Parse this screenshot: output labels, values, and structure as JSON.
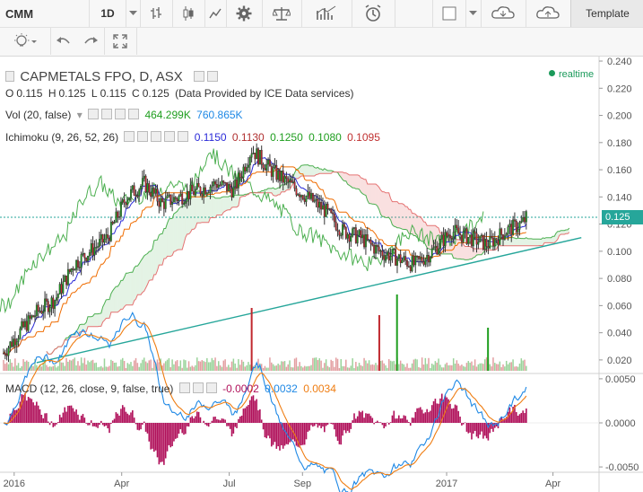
{
  "toolbar": {
    "symbol": "CMM",
    "timeframe": "1D",
    "template_label": "Template",
    "icons": [
      "chevron-down-icon",
      "bar-style-icon",
      "candles-icon",
      "area-style-icon",
      "settings-icon",
      "balance-icon",
      "indicators-icon",
      "add-alert-icon",
      "rectangle-icon",
      "chevron-down-icon",
      "cloud-load-icon",
      "cloud-save-icon"
    ],
    "row2_icons": [
      "bulb-icon",
      "undo-icon",
      "redo-icon",
      "fullscreen-icon"
    ]
  },
  "legend": {
    "title": "CAPMETALS FPO, D, ASX",
    "ohlc": {
      "o_label": "O",
      "o": "0.115",
      "h_label": "H",
      "h": "0.125",
      "l_label": "L",
      "l": "0.115",
      "c_label": "C",
      "c": "0.125"
    },
    "provider": "(Data Provided by ICE Data services)",
    "vol_label": "Vol (20, false)",
    "vol_value1": "464.299K",
    "vol_value2": "760.865K",
    "ichimoku_label": "Ichimoku (9, 26, 52, 26)",
    "ichimoku_values": [
      "0.1150",
      "0.1130",
      "0.1250",
      "0.1080",
      "0.1095"
    ],
    "ichimoku_colors": [
      "#2a2ad8",
      "#b03030",
      "#1f9e1f",
      "#1f9e1f",
      "#c03030"
    ],
    "macd_label": "MACD (12, 26, close, 9, false, true)",
    "macd_values": [
      "-0.0002",
      "0.0032",
      "0.0034"
    ],
    "macd_colors": [
      "#b0105a",
      "#1e88e5",
      "#ef7d12"
    ],
    "realtime": "realtime"
  },
  "colors": {
    "up": "#1f9e1f",
    "down": "#c0282e",
    "trend": "#26a69a",
    "tenkan": "#2a2ad8",
    "kijun": "#ef6c00",
    "lead_a": "#4caf50",
    "lead_b": "#e57373",
    "chikou": "#4caf50",
    "macd": "#1e88e5",
    "signal": "#ef7d12",
    "hist": "#b0105a"
  },
  "price_axis": {
    "ticks": [
      "0.240",
      "0.220",
      "0.200",
      "0.180",
      "0.160",
      "0.140",
      "0.120",
      "0.100",
      "0.080",
      "0.060",
      "0.040",
      "0.020"
    ],
    "last_price": "0.125"
  },
  "macd_axis": {
    "ticks": [
      "0.0050",
      "0.0000",
      "-0.0050"
    ]
  },
  "time_axis": {
    "ticks": [
      "2016",
      "Apr",
      "Jul",
      "Sep",
      "2017",
      "Apr"
    ]
  },
  "chart_data": {
    "type": "candlestick",
    "title": "CAPMETALS FPO, D, ASX",
    "ylim": [
      0.012,
      0.242
    ],
    "x_range": [
      "2015-12-20",
      "2017-05-10"
    ],
    "price_path": [
      {
        "date": "2015-12-23",
        "close": 0.025
      },
      {
        "date": "2016-01-05",
        "close": 0.04
      },
      {
        "date": "2016-01-20",
        "close": 0.055
      },
      {
        "date": "2016-02-05",
        "close": 0.065
      },
      {
        "date": "2016-02-20",
        "close": 0.09
      },
      {
        "date": "2016-03-05",
        "close": 0.1
      },
      {
        "date": "2016-03-20",
        "close": 0.11
      },
      {
        "date": "2016-04-05",
        "close": 0.14
      },
      {
        "date": "2016-04-20",
        "close": 0.15
      },
      {
        "date": "2016-05-05",
        "close": 0.135
      },
      {
        "date": "2016-05-20",
        "close": 0.14
      },
      {
        "date": "2016-06-05",
        "close": 0.145
      },
      {
        "date": "2016-06-20",
        "close": 0.15
      },
      {
        "date": "2016-07-05",
        "close": 0.145
      },
      {
        "date": "2016-07-20",
        "close": 0.175
      },
      {
        "date": "2016-08-05",
        "close": 0.16
      },
      {
        "date": "2016-08-20",
        "close": 0.15
      },
      {
        "date": "2016-09-05",
        "close": 0.14
      },
      {
        "date": "2016-09-20",
        "close": 0.13
      },
      {
        "date": "2016-10-05",
        "close": 0.115
      },
      {
        "date": "2016-10-20",
        "close": 0.11
      },
      {
        "date": "2016-11-05",
        "close": 0.1
      },
      {
        "date": "2016-11-20",
        "close": 0.095
      },
      {
        "date": "2016-12-05",
        "close": 0.09
      },
      {
        "date": "2016-12-20",
        "close": 0.1
      },
      {
        "date": "2017-01-05",
        "close": 0.115
      },
      {
        "date": "2017-01-20",
        "close": 0.11
      },
      {
        "date": "2017-02-05",
        "close": 0.105
      },
      {
        "date": "2017-02-20",
        "close": 0.115
      },
      {
        "date": "2017-03-05",
        "close": 0.12
      },
      {
        "date": "2017-03-10",
        "close": 0.125
      }
    ],
    "trendline": [
      {
        "date": "2016-01-20",
        "price": 0.018
      },
      {
        "date": "2017-04-25",
        "price": 0.11
      }
    ],
    "volume_spikes": [
      {
        "date": "2016-07-20",
        "color": "down"
      },
      {
        "date": "2016-11-05",
        "color": "down"
      },
      {
        "date": "2016-11-20",
        "color": "up"
      },
      {
        "date": "2017-02-05",
        "color": "up"
      }
    ],
    "macd_ylim": [
      -0.0055,
      0.0055
    ]
  }
}
